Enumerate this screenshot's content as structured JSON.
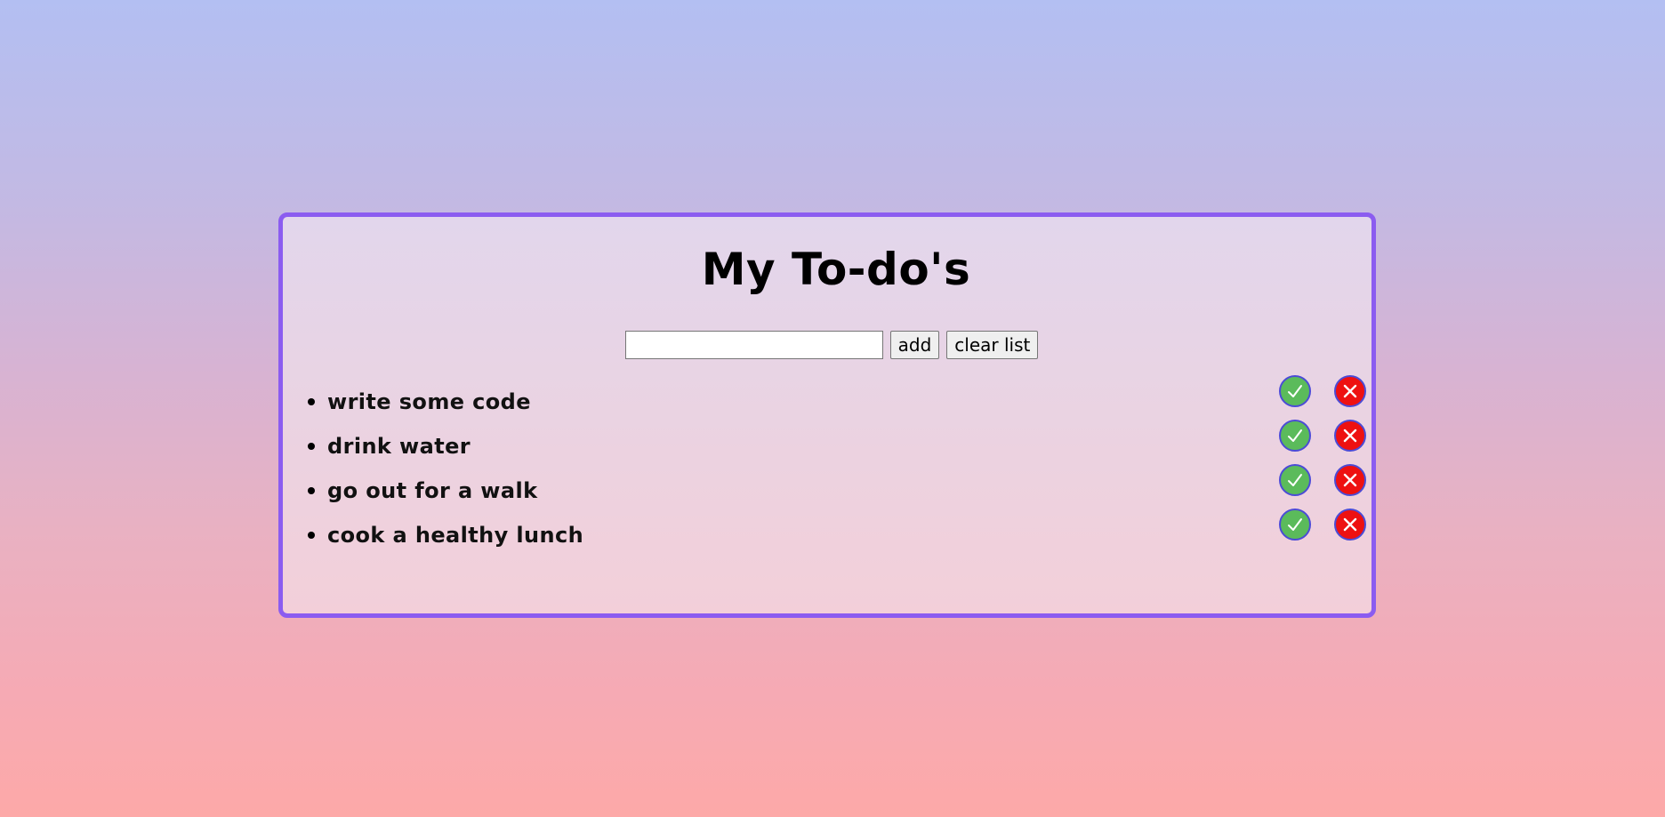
{
  "header": {
    "title": "My To-do's"
  },
  "form": {
    "input_value": "",
    "input_placeholder": "",
    "add_label": "add",
    "clear_label": "clear list"
  },
  "todos": [
    {
      "text": "write some code",
      "done_icon": "check-icon",
      "delete_icon": "x-icon"
    },
    {
      "text": "drink water",
      "done_icon": "check-icon",
      "delete_icon": "x-icon"
    },
    {
      "text": "go out for a walk",
      "done_icon": "check-icon",
      "delete_icon": "x-icon"
    },
    {
      "text": "cook a healthy lunch",
      "done_icon": "check-icon",
      "delete_icon": "x-icon"
    }
  ],
  "colors": {
    "card_border": "#8b5cf0",
    "done_button": "#5bbb5b",
    "delete_button": "#ee1111",
    "button_ring": "#4b4bd6"
  }
}
